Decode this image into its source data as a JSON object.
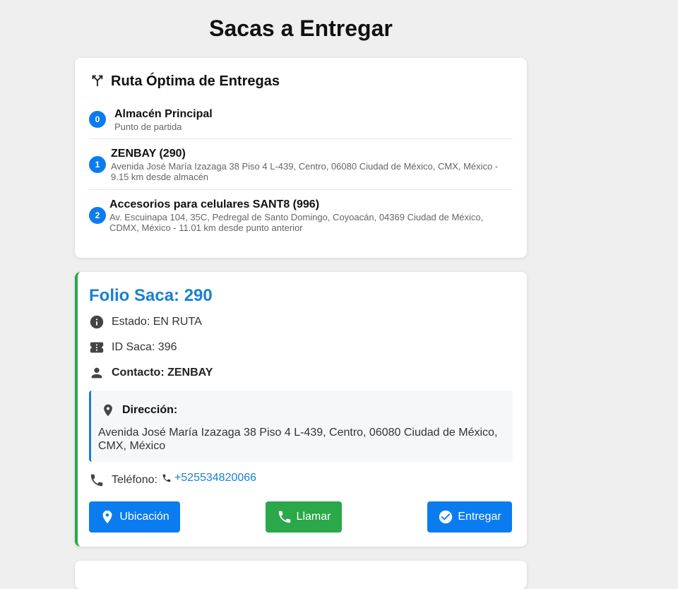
{
  "page": {
    "title": "Sacas a Entregar"
  },
  "route": {
    "title": "Ruta Óptima de Entregas",
    "icon": "route-fork-icon",
    "stops": [
      {
        "number": "0",
        "name": "Almacén Principal",
        "description": "Punto de partida"
      },
      {
        "number": "1",
        "name": "ZENBAY (290)",
        "description": "Avenida José María Izazaga 38 Piso 4 L-439, Centro, 06080 Ciudad de México, CMX, México - 9.15 km desde almacén"
      },
      {
        "number": "2",
        "name": "Accesorios para celulares SANT8 (996)",
        "description": "Av. Escuinapa 104, 35C, Pedregal de Santo Domingo, Coyoacán, 04369 Ciudad de México, CDMX, México - 11.01 km desde punto anterior"
      }
    ]
  },
  "saca": {
    "folio": "Folio Saca: 290",
    "estado": "Estado: EN RUTA",
    "id_saca": "ID Saca: 396",
    "contacto": "Contacto: ZENBAY",
    "direccion_label": "Dirección:",
    "direccion": "Avenida José María Izazaga 38 Piso 4 L-439, Centro, 06080 Ciudad de México, CMX, México",
    "telefono_label": "Teléfono:",
    "telefono": "+525534820066",
    "buttons": {
      "ubicacion": "Ubicación",
      "llamar": "Llamar",
      "entregar": "Entregar"
    },
    "accent_color": "#2aa84a"
  },
  "colors": {
    "primary": "#0a7cf0",
    "success": "#2aa84a",
    "link": "#1a7fd4"
  }
}
